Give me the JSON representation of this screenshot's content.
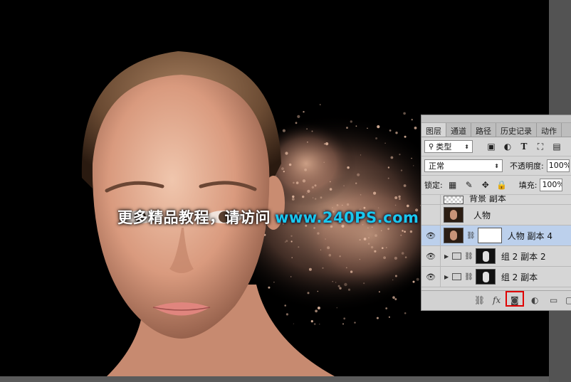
{
  "watermark": {
    "text": "更多精品教程，请访问",
    "url": "www.240PS.com"
  },
  "panel": {
    "tabs": [
      "图层",
      "通道",
      "路径",
      "历史记录",
      "动作"
    ],
    "active_tab": "图层",
    "filter": {
      "label": "类型"
    },
    "filter_icons": [
      "image-filter-icon",
      "adjustment-filter-icon",
      "type-filter-icon",
      "shape-filter-icon",
      "smart-object-filter-icon"
    ],
    "blend_mode": "正常",
    "opacity_label": "不透明度:",
    "opacity_value": "100%",
    "lock_label": "锁定:",
    "fill_label": "填充:",
    "fill_value": "100%",
    "layers": [
      {
        "name": "背景 副本",
        "visible": false,
        "partial": true
      },
      {
        "name": "人物",
        "visible": false
      },
      {
        "name": "人物 副本 4",
        "visible": true,
        "selected": true,
        "has_mask": true
      },
      {
        "name": "组 2 副本 2",
        "visible": true,
        "group": true
      },
      {
        "name": "组 2 副本",
        "visible": true,
        "group": true
      }
    ],
    "bottom_icons": [
      "link-layers-icon",
      "fx-icon",
      "add-mask-icon",
      "adjustment-layer-icon",
      "new-group-icon"
    ],
    "fx_label": "fx"
  },
  "colors": {
    "canvas_bg": "#000000",
    "panel_bg": "#d6d6d6",
    "selected_layer": "#bcd0ec",
    "watermark_url": "#19c8ee",
    "highlight_box": "#e00000"
  }
}
